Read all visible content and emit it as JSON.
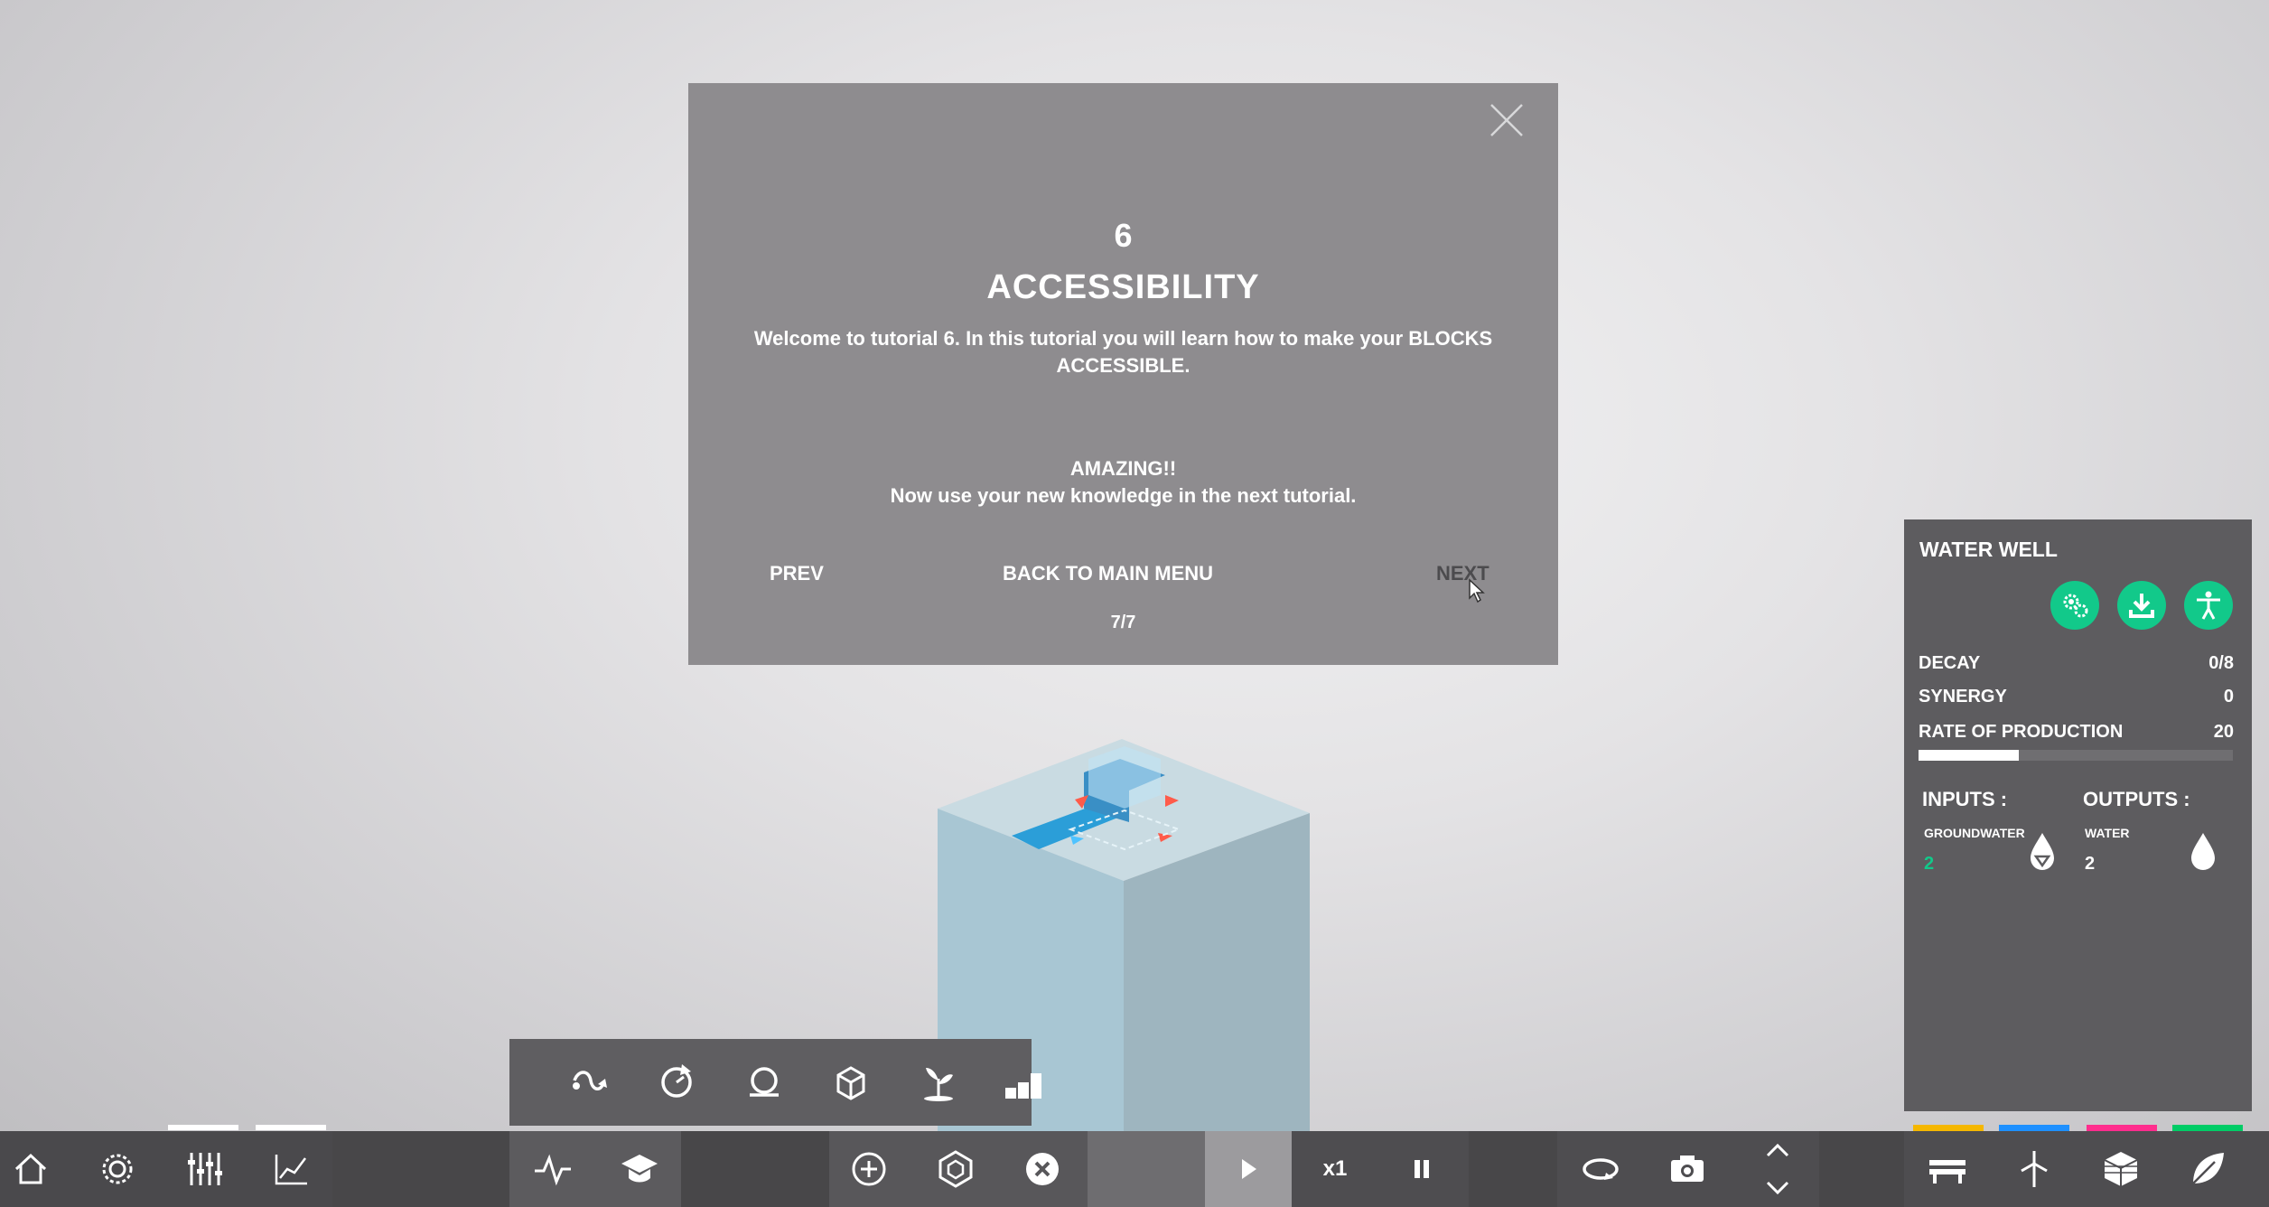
{
  "modal": {
    "number": "6",
    "title": "ACCESSIBILITY",
    "intro": "Welcome to tutorial 6. In this tutorial you will learn how to make your BLOCKS ACCESSIBLE.",
    "heading": "AMAZING!!",
    "message": "Now use your new knowledge in the next tutorial.",
    "prev_label": "PREV",
    "back_label": "BACK TO MAIN MENU",
    "next_label": "NEXT",
    "page": "7/7"
  },
  "panel": {
    "title": "WATER WELL",
    "stats": [
      {
        "label": "DECAY",
        "value": "0/8"
      },
      {
        "label": "SYNERGY",
        "value": "0"
      },
      {
        "label": "RATE OF PRODUCTION",
        "value": "20"
      }
    ],
    "production_fraction": 0.32,
    "inputs_label": "INPUTS :",
    "outputs_label": "OUTPUTS :",
    "input": {
      "name": "GROUNDWATER",
      "value": "2"
    },
    "output": {
      "name": "WATER",
      "value": "2"
    }
  },
  "toolbar": {
    "speed_label": "x1"
  },
  "colors": {
    "accent_green": "#12c98a",
    "category_yellow": "#f5b700",
    "category_blue": "#1e90ff",
    "category_pink": "#ff2d8d",
    "category_green": "#00cc66"
  }
}
